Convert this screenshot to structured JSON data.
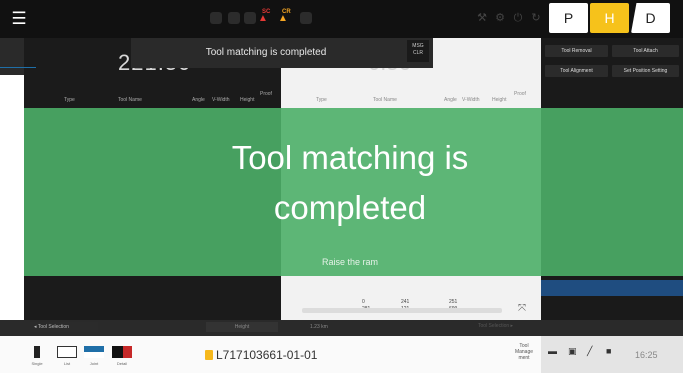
{
  "topbar": {
    "menu_icon": "hamburger-menu-icon",
    "warn1_label": "SC",
    "warn2_label": "CR",
    "modes": [
      "P",
      "H",
      "D"
    ]
  },
  "notification": {
    "text": "Tool matching is completed",
    "close_line1": "MSG",
    "close_line2": "CLR"
  },
  "left_panel": {
    "number": "221.50",
    "columns": [
      "Type",
      "Tool Name",
      "Angle",
      "V-Width",
      "Height",
      "Proof"
    ],
    "tool_selection": "Tool Selection",
    "button2": "Height"
  },
  "middle_panel": {
    "number": "0.56",
    "columns": [
      "Type",
      "Tool Name",
      "Angle",
      "V-Width",
      "Height",
      "Proof"
    ],
    "values_top": [
      "0",
      "241",
      "251"
    ],
    "values_bottom": [
      "281",
      "121",
      "699"
    ],
    "mini_label": "1.23 km",
    "tool_selection": "Tool Selection"
  },
  "right_panel": {
    "buttons": [
      "Tool Removal",
      "Tool Attach",
      "Tool Alignment",
      "Set Position Setting"
    ]
  },
  "overlay": {
    "message_line1": "Tool matching is",
    "message_line2": "completed",
    "sub_message": "Raise the ram"
  },
  "bottombar": {
    "thumbnails": [
      "Single",
      "List",
      "Joint",
      "Detail"
    ],
    "document_number": "L717103661-01-01",
    "tool_management": [
      "Tool",
      "Manage",
      "ment"
    ],
    "clock": "16:25"
  },
  "colors": {
    "accent_yellow": "#f6c21b",
    "overlay_green": "#4caf68",
    "warning_red": "#e53935",
    "warning_orange": "#f5a623"
  }
}
